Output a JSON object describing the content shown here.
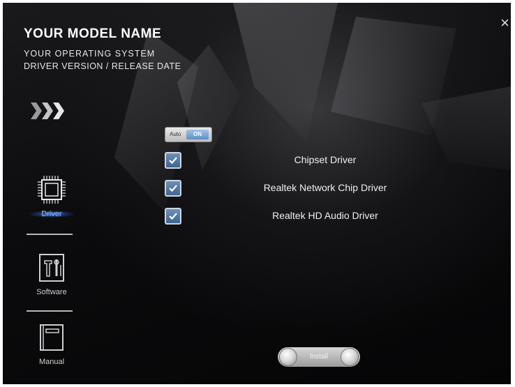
{
  "header": {
    "model": "YOUR MODEL NAME",
    "os": "YOUR OPERATING SYSTEM",
    "version": "DRIVER VERSION / RELEASE DATE"
  },
  "close_label": "×",
  "nav": {
    "driver": "Driver",
    "software": "Software",
    "manual": "Manual"
  },
  "auto_toggle": {
    "label": "Auto",
    "state": "ON"
  },
  "drivers": [
    {
      "name": "Chipset Driver",
      "checked": true
    },
    {
      "name": "Realtek Network Chip Driver",
      "checked": true
    },
    {
      "name": "Realtek HD Audio Driver",
      "checked": true
    }
  ],
  "install_label": "Install",
  "colors": {
    "accent": "#4d77a6",
    "glow": "#4f96ff"
  }
}
